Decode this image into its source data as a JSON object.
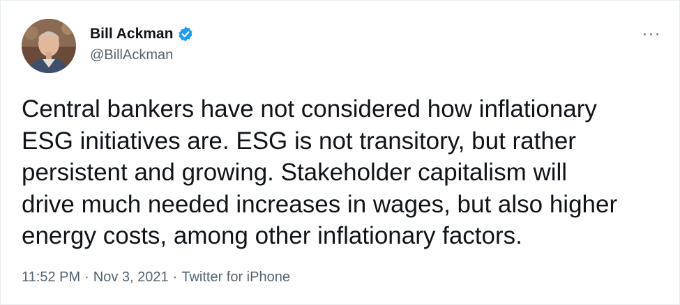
{
  "tweet": {
    "author": {
      "display_name": "Bill Ackman",
      "handle": "@BillAckman",
      "verified": true
    },
    "more_icon": "more-dots-icon",
    "text": "Central bankers have not considered how inflationary\nESG initiatives are. ESG is not transitory, but rather\npersistent and growing. Stakeholder capitalism will\ndrive much needed increases in wages, but also higher\nenergy costs, among other inflationary factors.",
    "time": "11:52 PM",
    "separator": "·",
    "date": "Nov 3, 2021",
    "source": "Twitter for iPhone"
  },
  "colors": {
    "text_primary": "#0f1419",
    "text_secondary": "#536471",
    "verified_blue": "#1d9bf0",
    "border": "#e6ecf0"
  }
}
